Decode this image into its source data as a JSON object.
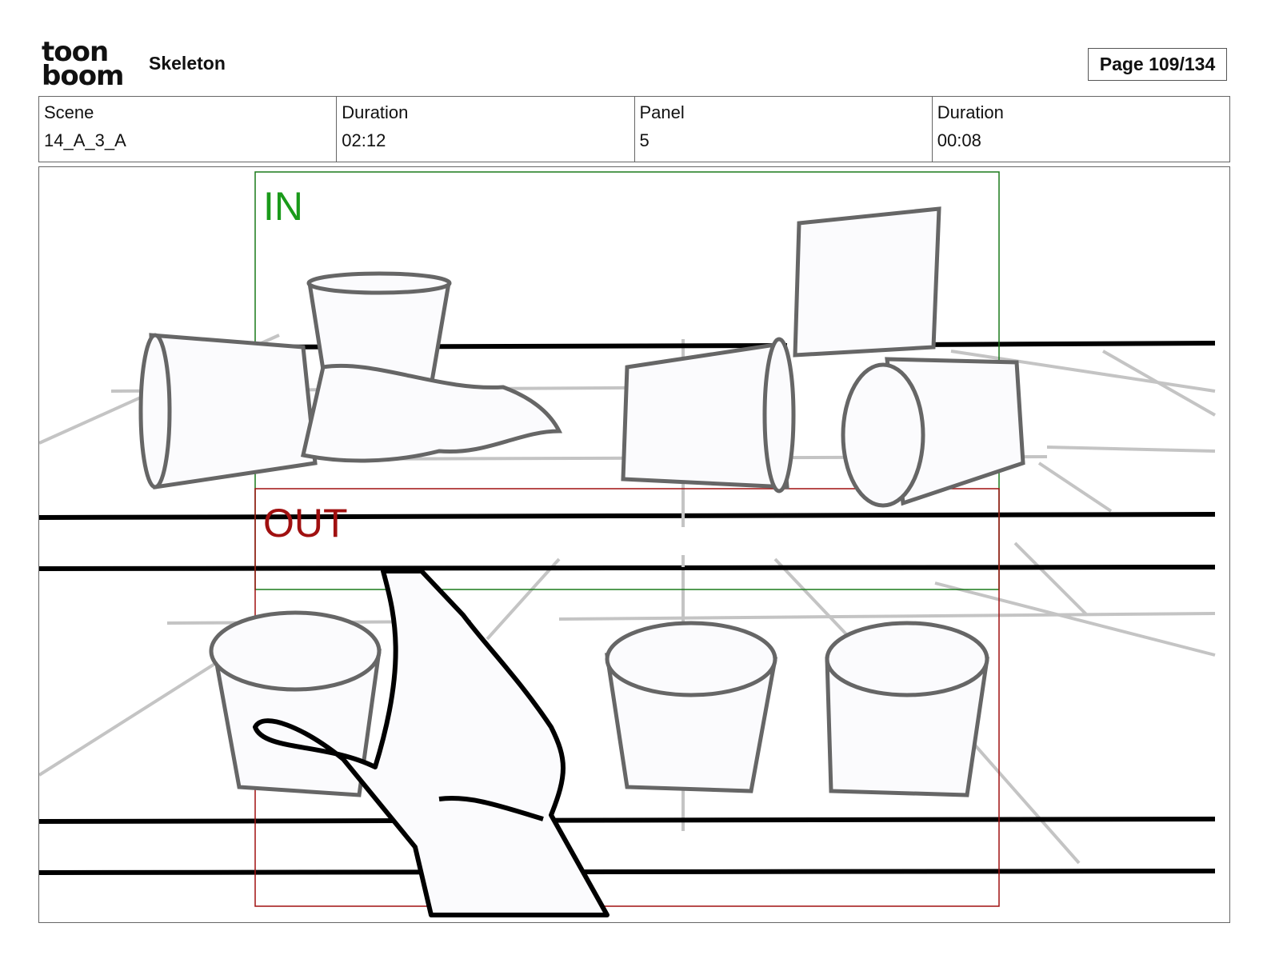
{
  "header": {
    "logo_text_top": "toon",
    "logo_text_bottom": "boom",
    "project_title": "Skeleton",
    "page_label": "Page 109/134"
  },
  "info": {
    "scene_label": "Scene",
    "scene_value": "14_A_3_A",
    "duration_label": "Duration",
    "duration_value": "02:12",
    "panel_label": "Panel",
    "panel_value": "5",
    "panel_duration_label": "Duration",
    "panel_duration_value": "00:08"
  },
  "panel": {
    "in_label": "IN",
    "out_label": "OUT",
    "in_color": "#1a8a1a",
    "out_color": "#a01010",
    "sketch_color": "#666666",
    "guide_color": "#c4c4c4",
    "line_color": "#000000"
  }
}
